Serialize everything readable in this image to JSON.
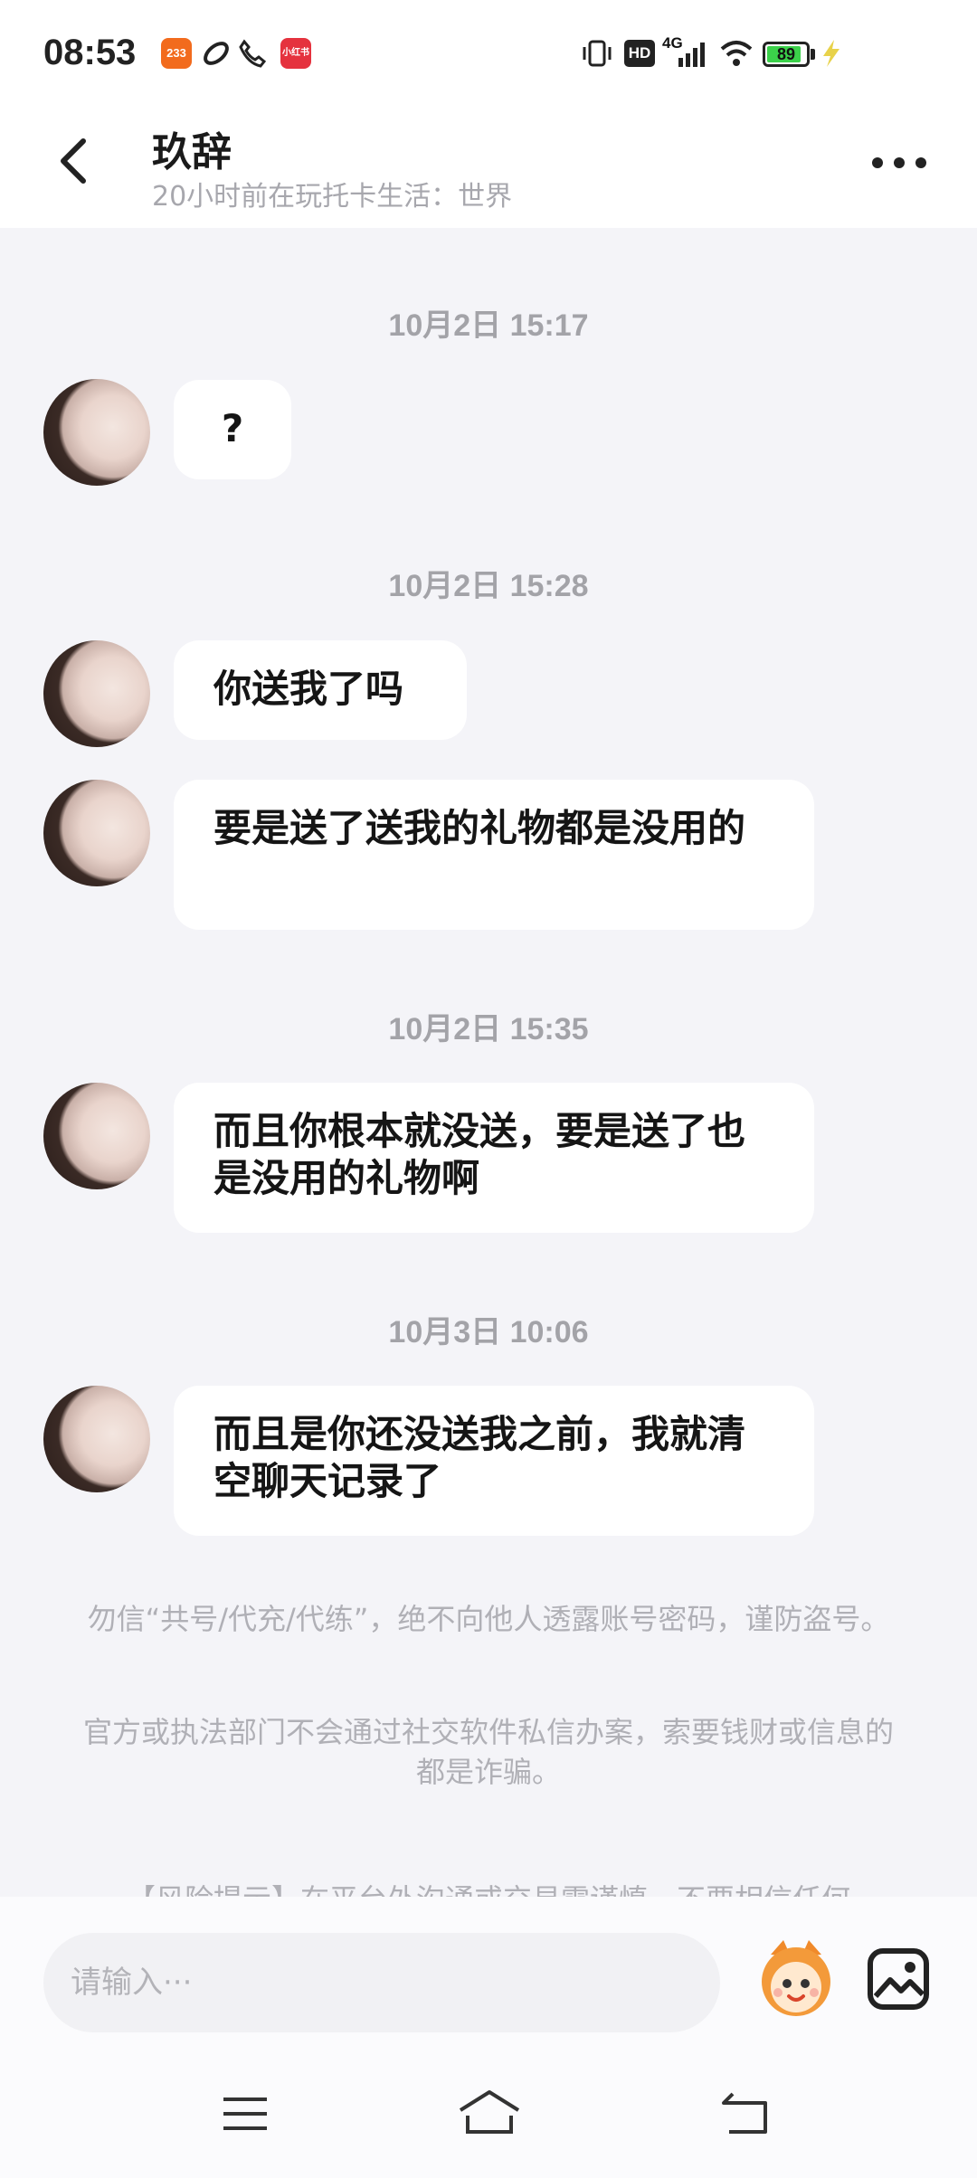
{
  "status_bar": {
    "time": "08:53",
    "app_badge_1": "233",
    "app_badge_2": "小红书",
    "hd_label": "HD",
    "network": "4G",
    "battery": "89",
    "battery_level_percent": 89,
    "battery_color": "#3bd14a"
  },
  "header": {
    "back_icon": "chevron-left-icon",
    "name": "玖辞",
    "status": "20小时前在玩托卡生活：世界",
    "more_icon": "more-dots-icon"
  },
  "messages": [
    {
      "timestamp": "10月2日 15:17",
      "bubbles": [
        "?"
      ]
    },
    {
      "timestamp": "10月2日 15:28",
      "bubbles": [
        "你送我了吗",
        "要是送了送我的礼物都是没用的"
      ]
    },
    {
      "timestamp": "10月2日 15:35",
      "bubbles": [
        "而且你根本就没送，要是送了也是没用的礼物啊"
      ]
    },
    {
      "timestamp": "10月3日 10:06",
      "bubbles": [
        "而且是你还没送我之前，我就清空聊天记录了"
      ]
    }
  ],
  "notices": [
    "勿信“共号/代充/代练”，绝不向他人透露账号密码，谨防盗号。",
    "官方或执法部门不会通过社交软件私信办案，索要钱财或信息的都是诈骗。",
    "【风险提示】在平台外沟通或交易需谨慎，不要相信任何"
  ],
  "input": {
    "placeholder": "请输入···",
    "emoji_icon": "mascot-emoji-icon",
    "image_icon": "image-picker-icon"
  },
  "nav": {
    "menu_icon": "menu-icon",
    "home_icon": "home-icon",
    "back_icon": "back-icon"
  },
  "colors": {
    "background": "#f4f4f8",
    "bubble": "#ffffff",
    "timestamp": "#a3a3a8",
    "notice": "#b0b0b6"
  }
}
